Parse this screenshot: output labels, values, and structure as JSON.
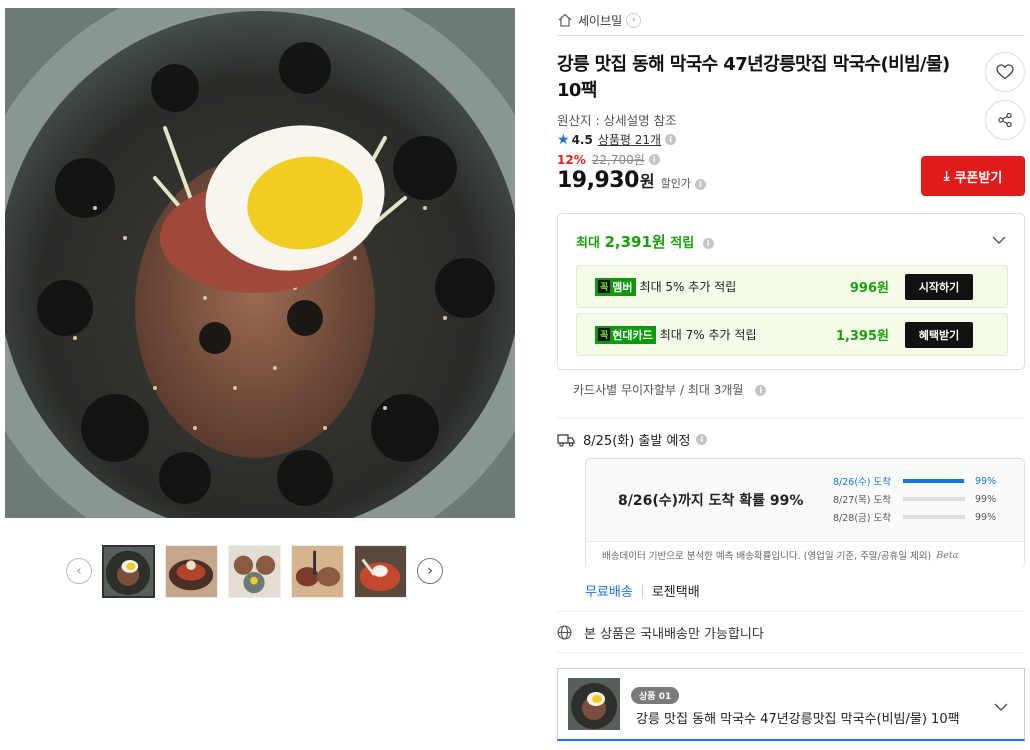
{
  "store": {
    "name": "세이브밀"
  },
  "product": {
    "title": "강릉 맛집 동해 막국수 47년강릉맛집 막국수(비빔/물) 10팩",
    "origin": "원산지 : 상세설명 참조",
    "rating": "4.5",
    "review_label": "상품평 21개",
    "discount": "12%",
    "original_price": "22,700원",
    "price": "19,930",
    "price_unit": "원",
    "sale_label": "할인가"
  },
  "buttons": {
    "coupon": "쿠폰받기",
    "start": "시작하기",
    "benefit": "혜택받기"
  },
  "reward": {
    "prefix": "최대",
    "amount": "2,391원",
    "suffix": "적립",
    "items": [
      {
        "tag_logo": "꼭",
        "tag": "멤버",
        "desc": "최대 5% 추가 적립",
        "value": "996원"
      },
      {
        "tag_logo": "꼭",
        "tag": "현대카드",
        "desc": "최대 7% 추가 적립",
        "value": "1,395원"
      }
    ]
  },
  "installment": "카드사별 무이자할부 / 최대 3개월",
  "shipping": {
    "date": "8/25(화) 출발 예정",
    "prob_title": "8/26(수)까지 도착 확률 99%",
    "rows": [
      {
        "label": "8/26(수) 도착",
        "pct": "99%",
        "level": 0.99
      },
      {
        "label": "8/27(목) 도착",
        "pct": "99%",
        "level": 0
      },
      {
        "label": "8/28(금) 도착",
        "pct": "99%",
        "level": 0
      }
    ],
    "footnote": "배송데이터 기반으로 분석한 예측 배송확률입니다. (영업일 기준, 주말/공휴일 제외)",
    "beta": "Beta",
    "free": "무료배송",
    "courier": "로젠택배",
    "domestic": "본 상품은 국내배송만 가능합니다"
  },
  "option": {
    "badge": "상품 01",
    "name": "강릉 맛집 동해 막국수 47년강릉맛집 막국수(비빔/물) 10팩"
  },
  "colors": {
    "accent_blue": "#1a73e8",
    "reward_green": "#1aa10d",
    "coupon_red": "#e01b1b",
    "discount_red": "#e2231a"
  },
  "icons": [
    "home-icon",
    "chevron-right-icon",
    "heart-icon",
    "share-icon",
    "star-icon",
    "info-icon",
    "download-icon",
    "chevron-down-icon",
    "truck-icon",
    "globe-icon",
    "arrow-left-icon",
    "arrow-right-icon"
  ]
}
